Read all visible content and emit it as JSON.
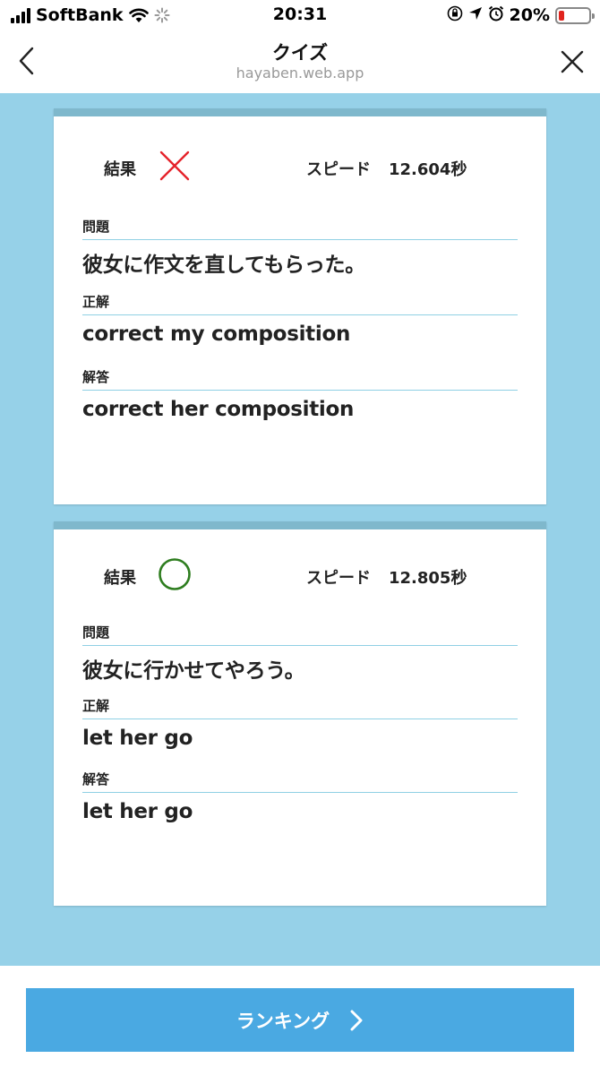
{
  "status_bar": {
    "carrier": "SoftBank",
    "time": "20:31",
    "battery_percent": "20%",
    "battery_level": 0.2,
    "battery_color": "#e0241d"
  },
  "nav": {
    "title": "クイズ",
    "subtitle": "hayaben.web.app",
    "back_icon": "chevron-left-icon",
    "close_icon": "close-icon"
  },
  "results": [
    {
      "result_label": "結果",
      "correct": false,
      "mark_icon": "cross-mark-icon",
      "mark_color": "#e5232b",
      "speed_label": "スピード",
      "speed_value": "12.604秒",
      "question_label": "問題",
      "question": "彼女に作文を直してもらった。",
      "answer_label": "正解",
      "answer": "correct my composition",
      "response_label": "解答",
      "response": "correct her composition"
    },
    {
      "result_label": "結果",
      "correct": true,
      "mark_icon": "circle-mark-icon",
      "mark_color": "#2e7d1f",
      "speed_label": "スピード",
      "speed_value": "12.805秒",
      "question_label": "問題",
      "question": "彼女に行かせてやろう。",
      "answer_label": "正解",
      "answer": "let her go",
      "response_label": "解答",
      "response": "let her go"
    }
  ],
  "footer": {
    "ranking_label": "ランキング",
    "ranking_icon": "chevron-right-icon",
    "accent_color": "#4aa9e2"
  }
}
